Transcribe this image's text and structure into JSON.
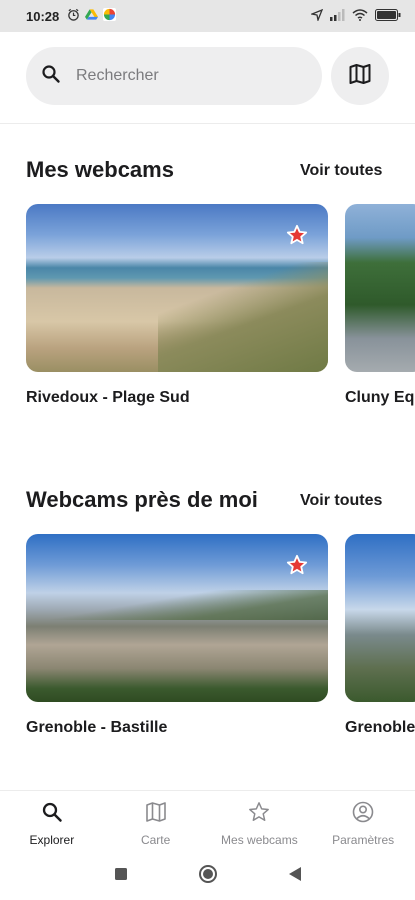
{
  "status_bar": {
    "time": "10:28",
    "icons_left": [
      "alarm-icon",
      "google-drive-icon",
      "photos-icon"
    ],
    "icons_right": [
      "location-icon",
      "signal-icon",
      "wifi-icon",
      "battery-icon"
    ]
  },
  "search": {
    "placeholder": "Rechercher",
    "value": "",
    "map_button_icon": "map-icon"
  },
  "sections": [
    {
      "title": "Mes webcams",
      "see_all_label": "Voir toutes",
      "cards": [
        {
          "label": "Rivedoux - Plage Sud",
          "favorite": true
        },
        {
          "label": "Cluny Eq"
        }
      ]
    },
    {
      "title": "Webcams près de moi",
      "see_all_label": "Voir toutes",
      "cards": [
        {
          "label": "Grenoble - Bastille",
          "favorite": true
        },
        {
          "label": "Grenoble"
        }
      ]
    }
  ],
  "bottom_nav": {
    "items": [
      {
        "label": "Explorer",
        "icon": "search-icon",
        "active": true
      },
      {
        "label": "Carte",
        "icon": "map-icon",
        "active": false
      },
      {
        "label": "Mes webcams",
        "icon": "star-icon",
        "active": false
      },
      {
        "label": "Paramètres",
        "icon": "account-icon",
        "active": false
      }
    ]
  },
  "system_nav": {
    "icons": [
      "recents-square-icon",
      "home-circle-icon",
      "back-triangle-icon"
    ]
  },
  "colors": {
    "accent_favorite": "#e53935",
    "search_background": "#eeeeef",
    "active_text": "#1c1c1e",
    "inactive_text": "#8a8a8e"
  }
}
